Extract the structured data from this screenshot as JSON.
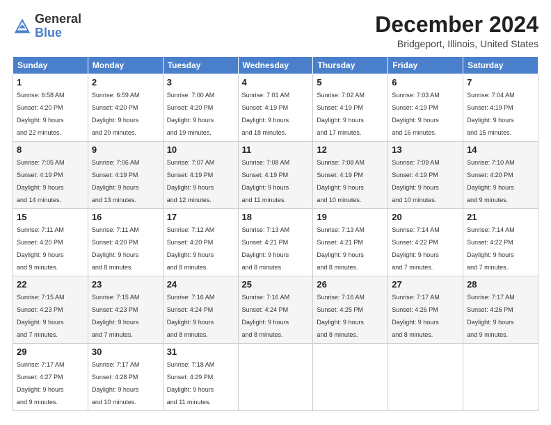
{
  "logo": {
    "general": "General",
    "blue": "Blue"
  },
  "title": "December 2024",
  "subtitle": "Bridgeport, Illinois, United States",
  "days_of_week": [
    "Sunday",
    "Monday",
    "Tuesday",
    "Wednesday",
    "Thursday",
    "Friday",
    "Saturday"
  ],
  "weeks": [
    [
      {
        "day": "1",
        "sunrise": "6:58 AM",
        "sunset": "4:20 PM",
        "daylight": "9 hours and 22 minutes."
      },
      {
        "day": "2",
        "sunrise": "6:59 AM",
        "sunset": "4:20 PM",
        "daylight": "9 hours and 20 minutes."
      },
      {
        "day": "3",
        "sunrise": "7:00 AM",
        "sunset": "4:20 PM",
        "daylight": "9 hours and 19 minutes."
      },
      {
        "day": "4",
        "sunrise": "7:01 AM",
        "sunset": "4:19 PM",
        "daylight": "9 hours and 18 minutes."
      },
      {
        "day": "5",
        "sunrise": "7:02 AM",
        "sunset": "4:19 PM",
        "daylight": "9 hours and 17 minutes."
      },
      {
        "day": "6",
        "sunrise": "7:03 AM",
        "sunset": "4:19 PM",
        "daylight": "9 hours and 16 minutes."
      },
      {
        "day": "7",
        "sunrise": "7:04 AM",
        "sunset": "4:19 PM",
        "daylight": "9 hours and 15 minutes."
      }
    ],
    [
      {
        "day": "8",
        "sunrise": "7:05 AM",
        "sunset": "4:19 PM",
        "daylight": "9 hours and 14 minutes."
      },
      {
        "day": "9",
        "sunrise": "7:06 AM",
        "sunset": "4:19 PM",
        "daylight": "9 hours and 13 minutes."
      },
      {
        "day": "10",
        "sunrise": "7:07 AM",
        "sunset": "4:19 PM",
        "daylight": "9 hours and 12 minutes."
      },
      {
        "day": "11",
        "sunrise": "7:08 AM",
        "sunset": "4:19 PM",
        "daylight": "9 hours and 11 minutes."
      },
      {
        "day": "12",
        "sunrise": "7:08 AM",
        "sunset": "4:19 PM",
        "daylight": "9 hours and 10 minutes."
      },
      {
        "day": "13",
        "sunrise": "7:09 AM",
        "sunset": "4:19 PM",
        "daylight": "9 hours and 10 minutes."
      },
      {
        "day": "14",
        "sunrise": "7:10 AM",
        "sunset": "4:20 PM",
        "daylight": "9 hours and 9 minutes."
      }
    ],
    [
      {
        "day": "15",
        "sunrise": "7:11 AM",
        "sunset": "4:20 PM",
        "daylight": "9 hours and 9 minutes."
      },
      {
        "day": "16",
        "sunrise": "7:11 AM",
        "sunset": "4:20 PM",
        "daylight": "9 hours and 8 minutes."
      },
      {
        "day": "17",
        "sunrise": "7:12 AM",
        "sunset": "4:20 PM",
        "daylight": "9 hours and 8 minutes."
      },
      {
        "day": "18",
        "sunrise": "7:13 AM",
        "sunset": "4:21 PM",
        "daylight": "9 hours and 8 minutes."
      },
      {
        "day": "19",
        "sunrise": "7:13 AM",
        "sunset": "4:21 PM",
        "daylight": "9 hours and 8 minutes."
      },
      {
        "day": "20",
        "sunrise": "7:14 AM",
        "sunset": "4:22 PM",
        "daylight": "9 hours and 7 minutes."
      },
      {
        "day": "21",
        "sunrise": "7:14 AM",
        "sunset": "4:22 PM",
        "daylight": "9 hours and 7 minutes."
      }
    ],
    [
      {
        "day": "22",
        "sunrise": "7:15 AM",
        "sunset": "4:23 PM",
        "daylight": "9 hours and 7 minutes."
      },
      {
        "day": "23",
        "sunrise": "7:15 AM",
        "sunset": "4:23 PM",
        "daylight": "9 hours and 7 minutes."
      },
      {
        "day": "24",
        "sunrise": "7:16 AM",
        "sunset": "4:24 PM",
        "daylight": "9 hours and 8 minutes."
      },
      {
        "day": "25",
        "sunrise": "7:16 AM",
        "sunset": "4:24 PM",
        "daylight": "9 hours and 8 minutes."
      },
      {
        "day": "26",
        "sunrise": "7:16 AM",
        "sunset": "4:25 PM",
        "daylight": "9 hours and 8 minutes."
      },
      {
        "day": "27",
        "sunrise": "7:17 AM",
        "sunset": "4:26 PM",
        "daylight": "9 hours and 8 minutes."
      },
      {
        "day": "28",
        "sunrise": "7:17 AM",
        "sunset": "4:26 PM",
        "daylight": "9 hours and 9 minutes."
      }
    ],
    [
      {
        "day": "29",
        "sunrise": "7:17 AM",
        "sunset": "4:27 PM",
        "daylight": "9 hours and 9 minutes."
      },
      {
        "day": "30",
        "sunrise": "7:17 AM",
        "sunset": "4:28 PM",
        "daylight": "9 hours and 10 minutes."
      },
      {
        "day": "31",
        "sunrise": "7:18 AM",
        "sunset": "4:29 PM",
        "daylight": "9 hours and 11 minutes."
      },
      null,
      null,
      null,
      null
    ]
  ]
}
